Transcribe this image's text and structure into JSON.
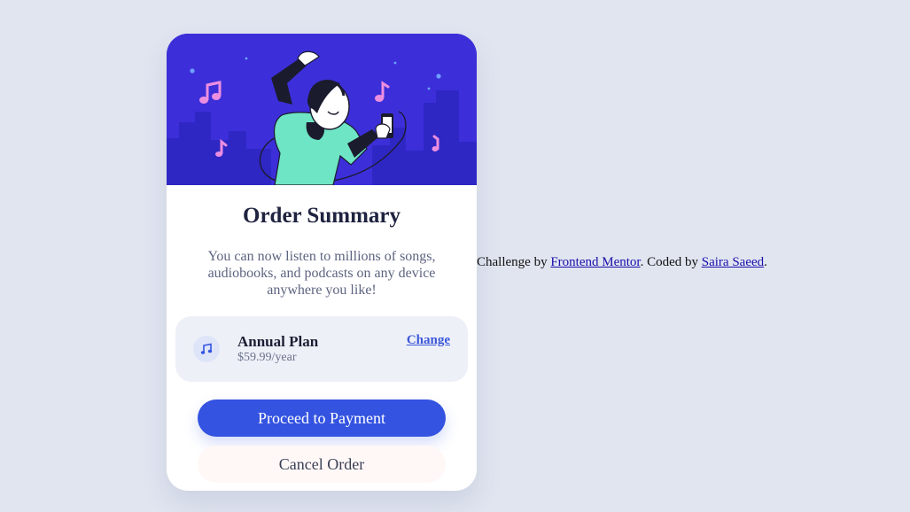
{
  "card": {
    "title": "Order Summary",
    "description": "You can now listen to millions of songs, audiobooks, and podcasts on any device anywhere you like!",
    "plan": {
      "icon": "music-note-icon",
      "name": "Annual Plan",
      "price": "$59.99/year",
      "change_label": "Change"
    },
    "proceed_label": "Proceed to Payment",
    "cancel_label": "Cancel Order"
  },
  "attribution": {
    "prefix": "Challenge by ",
    "frontend_mentor": "Frontend Mentor",
    "middle": ". Coded by ",
    "author": "Saira Saeed",
    "suffix": "."
  },
  "colors": {
    "page_background": "#e1e5f0",
    "hero_background": "#3c2fd9",
    "primary_button": "#3453e0",
    "link": "#3b57d8",
    "plan_box": "#eef0f8"
  }
}
